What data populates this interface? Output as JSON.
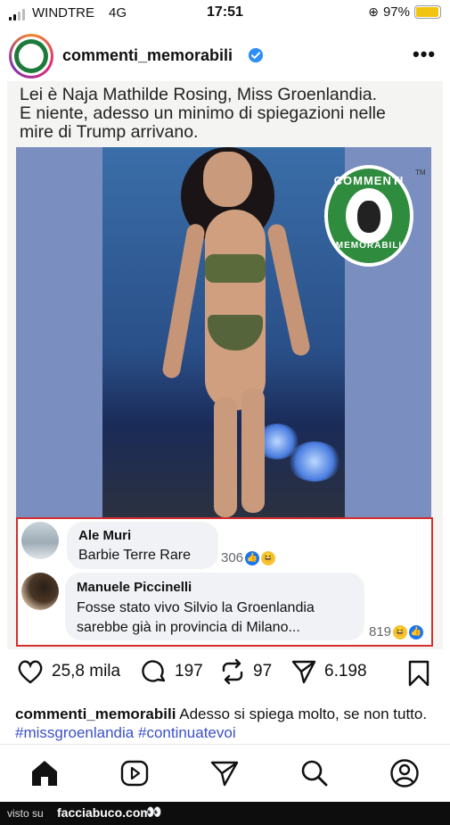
{
  "status_bar": {
    "carrier": "WINDTRE",
    "network": "4G",
    "time": "17:51",
    "battery": "97%",
    "battery_level": 0.97
  },
  "header": {
    "username": "commenti_memorabili",
    "more_label": "•••"
  },
  "post": {
    "text_lines": [
      "Lei è Naja Mathilde Rosing, Miss Groenlandia.",
      "E niente, adesso un minimo di spiegazioni nelle",
      "mire di Trump arrivano."
    ],
    "badge_top": "COMMENTI",
    "badge_bottom": "MEMORABILI",
    "badge_tm": "TM",
    "comments": [
      {
        "name": "Ale Muri",
        "text": "Barbie Terre Rare",
        "count": "306"
      },
      {
        "name": "Manuele Piccinelli",
        "text_line1": "Fosse stato vivo Silvio la Groenlandia",
        "text_line2": "sarebbe già in provincia di Milano...",
        "count": "819"
      }
    ]
  },
  "actions": {
    "likes": "25,8 mila",
    "comments": "197",
    "reposts": "97",
    "shares": "6.198"
  },
  "caption": {
    "username": "commenti_memorabili",
    "text": " Adesso si spiega molto, se non tutto. ",
    "tag1": "#missgroenlandia",
    "tag2": "#continuatevoi"
  },
  "footer": {
    "visto_su": "visto su",
    "site": "facciabuco.com",
    "eyes": "👀"
  },
  "colors": {
    "verified": "#2f8ff5",
    "hashtag": "#3a50c8",
    "comment_box_border": "#d62d2d",
    "badge_green": "#2f8b3e"
  }
}
